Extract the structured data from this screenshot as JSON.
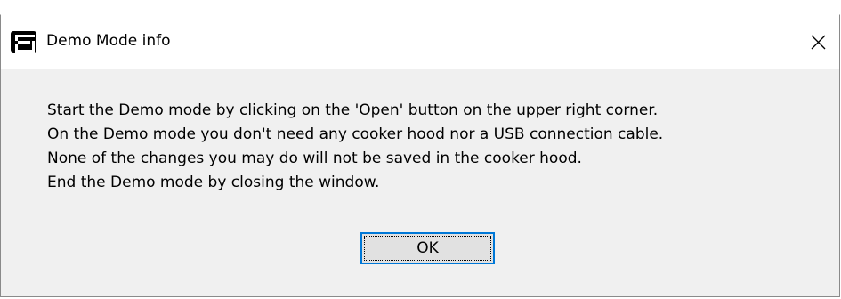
{
  "window": {
    "title": "Demo Mode info",
    "icon": "app-s-icon",
    "close_icon": "close-icon"
  },
  "message": {
    "lines": [
      "Start the Demo mode by clicking on the 'Open' button on the upper right corner.",
      "On the Demo mode you don't need any cooker hood nor a USB connection cable.",
      "None of the changes you may do will not be saved in the cooker hood.",
      "End the Demo mode by closing the window."
    ]
  },
  "buttons": {
    "ok_label": "OK"
  },
  "colors": {
    "focus_border": "#0078d7",
    "dialog_background": "#f0f0f0",
    "titlebar_background": "#ffffff"
  }
}
